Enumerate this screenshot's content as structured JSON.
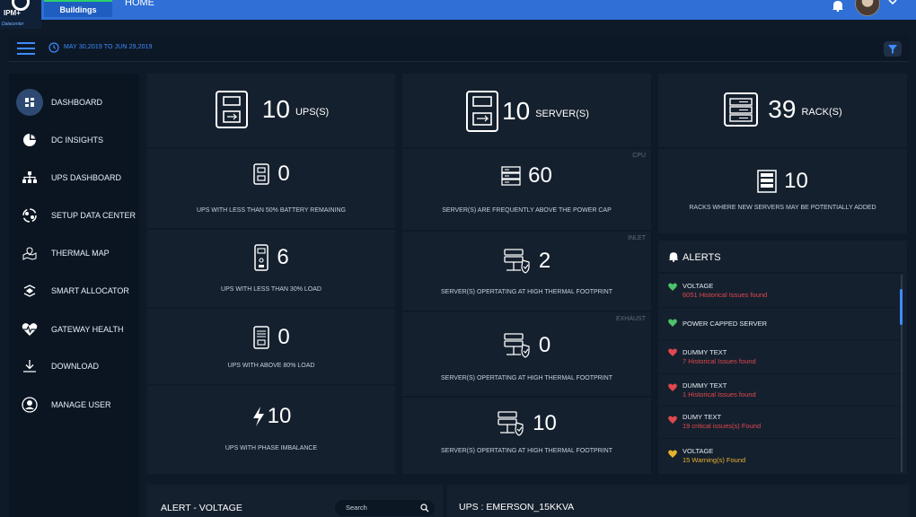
{
  "header": {
    "logo_text": "IPM+",
    "logo_sub": "Datacenter",
    "tab_label": "Buildings",
    "title": "HOME"
  },
  "filter": {
    "date_range": "MAY 30,2019 TO JUN 29,2019"
  },
  "sidebar": {
    "items": [
      {
        "label": "DASHBOARD",
        "icon": "dashboard-icon",
        "active": true
      },
      {
        "label": "DC INSIGHTS",
        "icon": "pie-chart-icon"
      },
      {
        "label": "UPS DASHBOARD",
        "icon": "hierarchy-icon"
      },
      {
        "label": "SETUP DATA CENTER",
        "icon": "setup-icon"
      },
      {
        "label": "THERMAL MAP",
        "icon": "map-icon"
      },
      {
        "label": "SMART ALLOCATOR",
        "icon": "allocator-icon"
      },
      {
        "label": "GATEWAY HEALTH",
        "icon": "heartbeat-icon"
      },
      {
        "label": "DOWNLOAD",
        "icon": "download-icon"
      },
      {
        "label": "MANAGE USER",
        "icon": "user-icon"
      }
    ]
  },
  "ups": {
    "count": "10",
    "unit": "UPS(S)",
    "cells": [
      {
        "value": "0",
        "desc": "UPS WITH LESS THAN 50% BATTERY REMAINING"
      },
      {
        "value": "6",
        "desc": "UPS WITH LESS THAN 30% LOAD"
      },
      {
        "value": "0",
        "desc": "UPS WITH ABOVE 80% LOAD"
      },
      {
        "value": "10",
        "desc": "UPS WITH PHASE IMBALANCE"
      }
    ]
  },
  "server": {
    "count": "10",
    "unit": "SERVER(S)",
    "cells": [
      {
        "tag": "CPU",
        "value": "60",
        "desc": "SERVER(S) ARE FREQUENTLY ABOVE THE POWER CAP"
      },
      {
        "tag": "INLET",
        "value": "2",
        "desc": "SERVER(S) OPERTATING AT HIGH  THERMAL FOOTPRINT"
      },
      {
        "tag": "EXHAUST",
        "value": "0",
        "desc": "SERVER(S) OPERTATING AT HIGH  THERMAL FOOTPRINT"
      },
      {
        "tag": "",
        "value": "10",
        "desc": "SERVER(S) OPERTATING AT HIGH THERMAL FOOTPRINT"
      }
    ]
  },
  "rack": {
    "count": "39",
    "unit": "RACK(S)",
    "cell": {
      "value": "10",
      "desc": "RACKS WHERE NEW SERVERS MAY BE POTENTIALLY ADDED"
    }
  },
  "alerts": {
    "title": "ALERTS",
    "items": [
      {
        "title": "VOLTAGE",
        "sub": "6051 Historical Issues found",
        "color": "#4cc26a",
        "sub_color": "#e0484e"
      },
      {
        "title": "POWER CAPPED SERVER",
        "sub": "",
        "color": "#4cc26a",
        "sub_color": "#e0484e"
      },
      {
        "title": "DUMMY TEXT",
        "sub": "7 Historical Issues found",
        "color": "#e0484e",
        "sub_color": "#e0484e"
      },
      {
        "title": "DUMMY TEXT",
        "sub": "1 Historical Issues found",
        "color": "#e0484e",
        "sub_color": "#e0484e"
      },
      {
        "title": "DUMY TEXT",
        "sub": "19 critical issues(s) Found",
        "color": "#e0484e",
        "sub_color": "#e0484e"
      },
      {
        "title": "VOLTAGE",
        "sub": "15 Warning(s) Found",
        "color": "#e6b12c",
        "sub_color": "#e6b12c"
      }
    ]
  },
  "bottom": {
    "left_title": "ALERT - VOLTAGE",
    "search_placeholder": "Search",
    "right_title": "UPS : EMERSON_15KKVA"
  }
}
